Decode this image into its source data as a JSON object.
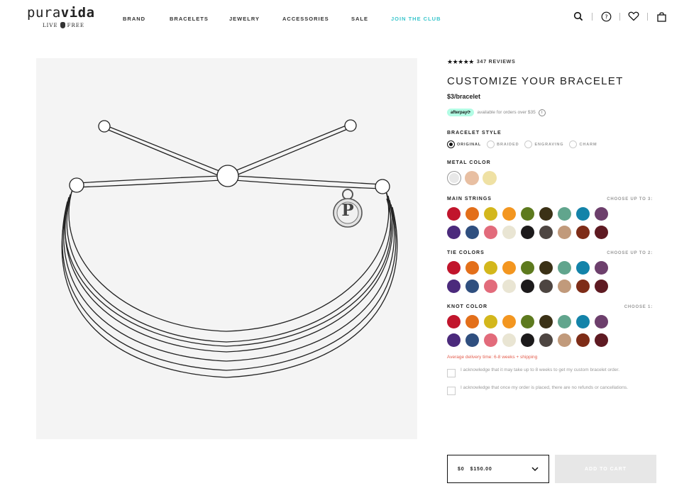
{
  "header": {
    "logo_main_a": "pura",
    "logo_main_b": "vida",
    "logo_tag_left": "LIVE",
    "logo_tag_right": "FREE",
    "nav": [
      "BRAND",
      "BRACELETS",
      "JEWELRY",
      "ACCESSORIES",
      "SALE",
      "JOIN THE CLUB"
    ],
    "icons": [
      "search-icon",
      "help-icon",
      "heart-icon",
      "bag-icon"
    ]
  },
  "product": {
    "stars": "★★★★★",
    "reviews": "347 REVIEWS",
    "title": "CUSTOMIZE YOUR BRACELET",
    "price": "$3/bracelet",
    "afterpay_badge": "afterpay⟳",
    "afterpay_text": "available for orders over $35",
    "charm_letter": "P"
  },
  "bracelet_style": {
    "label": "BRACELET STYLE",
    "options": [
      "ORIGINAL",
      "BRAIDED",
      "ENGRAVING",
      "CHARM"
    ],
    "selected": "ORIGINAL"
  },
  "metal_color": {
    "label": "METAL COLOR",
    "colors": [
      "#e8e8e8",
      "#e8bfa2",
      "#efe1a4"
    ]
  },
  "main_strings": {
    "label": "MAIN STRINGS",
    "choose": "CHOOSE UP TO 3:"
  },
  "tie_colors": {
    "label": "TIE COLORS",
    "choose": "CHOOSE UP TO 2:"
  },
  "knot_color": {
    "label": "KNOT COLOR",
    "choose": "CHOOSE 1:"
  },
  "palette": [
    "#c1152c",
    "#e36f1a",
    "#d3b71c",
    "#f39620",
    "#5d7a1e",
    "#3b3116",
    "#61a58d",
    "#1383a9",
    "#6d3f6c",
    "#4b2a7c",
    "#2f4f7f",
    "#e26b7b",
    "#e9e5d3",
    "#1c1a1b",
    "#4d4541",
    "#c19a7b",
    "#7e2c17",
    "#5e1a22"
  ],
  "delivery": "Average delivery time: 6-8 weeks + shipping",
  "acknowledgements": [
    "I acknowledge that it may take up to 8 weeks to get my custom bracelet order.",
    "I acknowledge that once my order is placed, there are no refunds or cancellations."
  ],
  "purchase": {
    "price_left": "$0",
    "price_right": "$150.00",
    "add_to_cart": "ADD TO CART"
  }
}
